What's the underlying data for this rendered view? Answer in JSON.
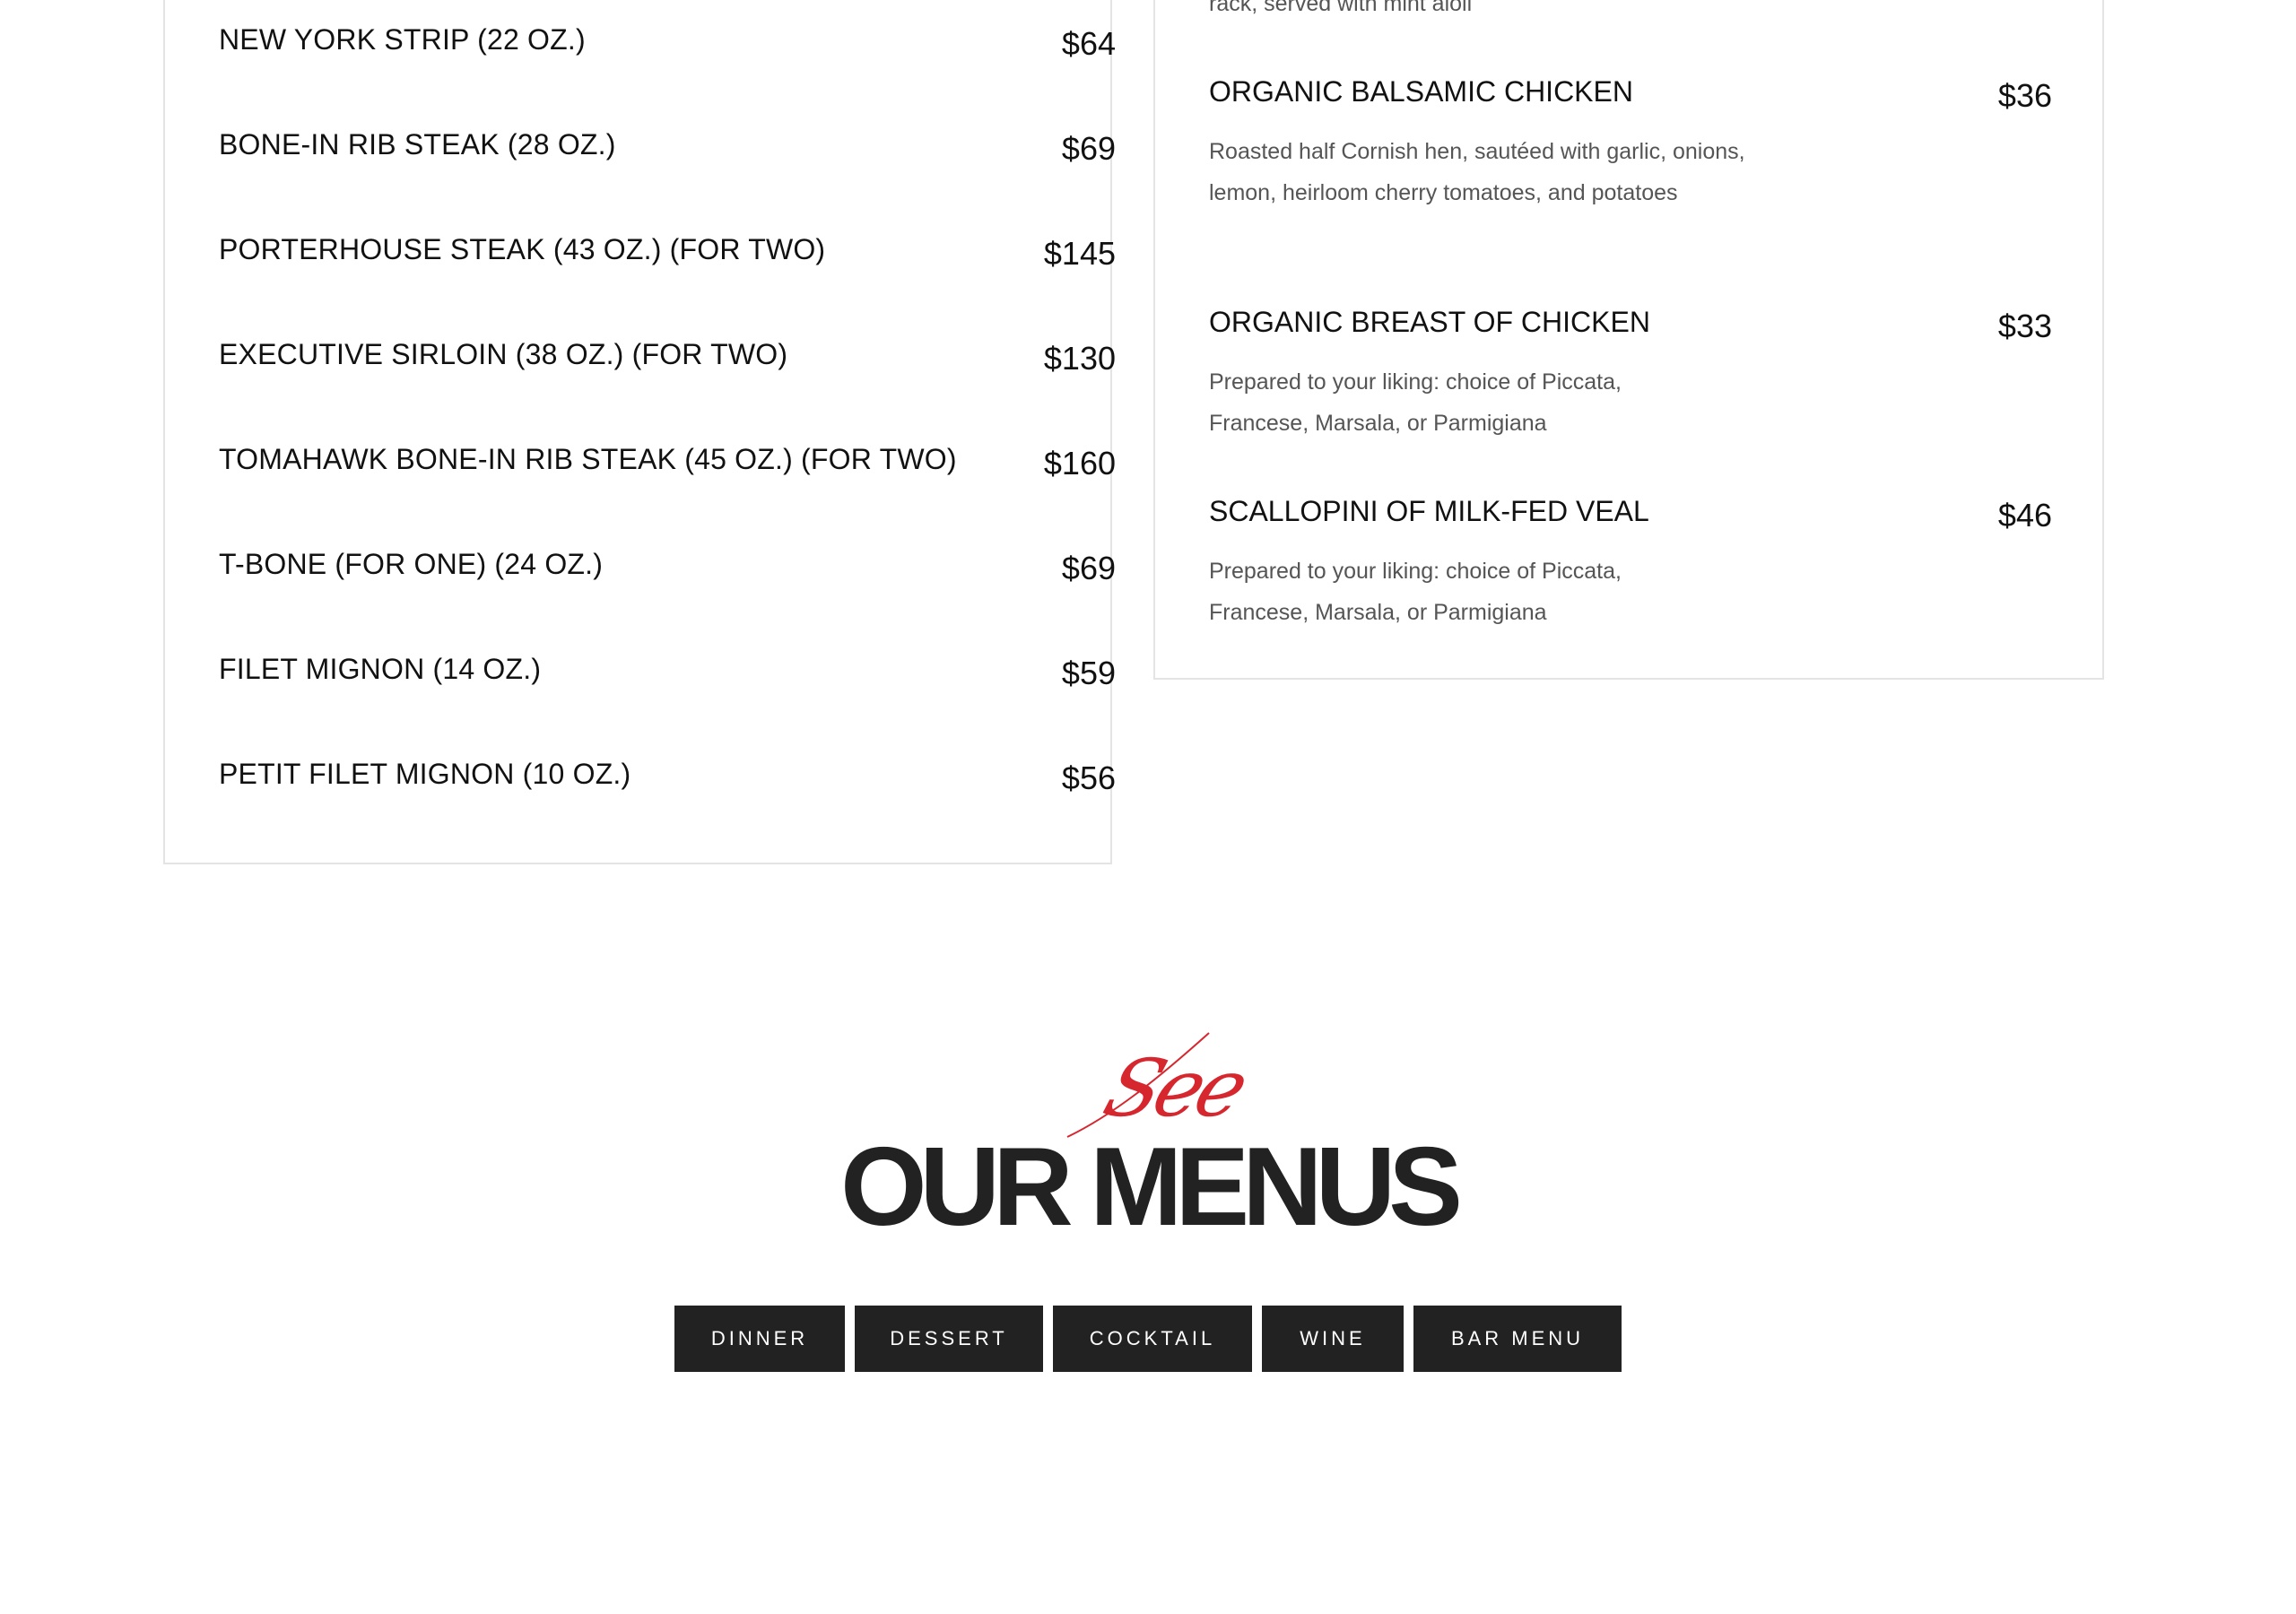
{
  "steaks": [
    {
      "name": "NEW YORK STRIP (22 OZ.)",
      "price": "$64"
    },
    {
      "name": "BONE-IN RIB STEAK (28 OZ.)",
      "price": "$69"
    },
    {
      "name": "PORTERHOUSE STEAK (43 OZ.) (FOR TWO)",
      "price": "$145"
    },
    {
      "name": "EXECUTIVE SIRLOIN (38 OZ.) (FOR TWO)",
      "price": "$130"
    },
    {
      "name": "TOMAHAWK BONE-IN RIB STEAK (45 OZ.) (FOR TWO)",
      "price": "$160"
    },
    {
      "name": "T-BONE (FOR ONE) (24 OZ.)",
      "price": "$69"
    },
    {
      "name": "FILET MIGNON (14 OZ.)",
      "price": "$59"
    },
    {
      "name": "PETIT FILET MIGNON (10 OZ.)",
      "price": "$56"
    }
  ],
  "entrees": {
    "cut_off_description": "rack, served with mint aioli",
    "items": [
      {
        "name": "ORGANIC BALSAMIC CHICKEN",
        "price": "$36",
        "description": "Roasted half Cornish hen, sautéed with garlic, onions, lemon, heirloom cherry tomatoes, and potatoes"
      },
      {
        "name": "ORGANIC BREAST OF CHICKEN",
        "price": "$33",
        "description": "Prepared to your liking: choice of Piccata, Francese, Marsala, or Parmigiana"
      },
      {
        "name": "SCALLOPINI OF MILK-FED VEAL",
        "price": "$46",
        "description": "Prepared to your liking: choice of Piccata, Francese, Marsala, or Parmigiana"
      }
    ]
  },
  "section": {
    "script_word": "See",
    "title": "OUR MENUS",
    "accent_color": "#d6262e"
  },
  "menu_nav": [
    {
      "label": "DINNER"
    },
    {
      "label": "DESSERT"
    },
    {
      "label": "COCKTAIL"
    },
    {
      "label": "WINE"
    },
    {
      "label": "BAR MENU"
    }
  ]
}
